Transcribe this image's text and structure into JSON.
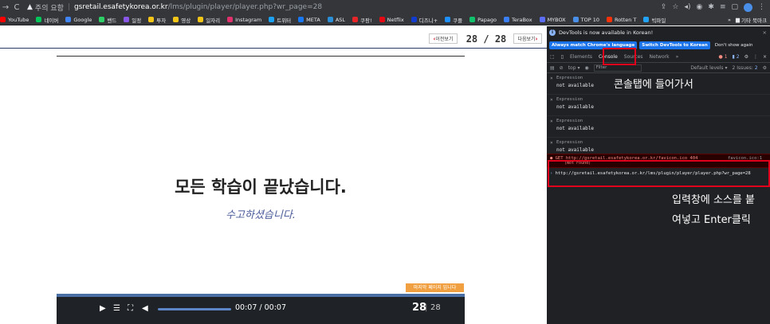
{
  "browser": {
    "warning": "주의 요함",
    "host": "gsretail.esafetykorea.or.kr",
    "path": "/lms/plugin/player/player.php?wr_page=28",
    "bookmarks": [
      {
        "label": "YouTube",
        "color": "#ff0000"
      },
      {
        "label": "네이버",
        "color": "#03c75a"
      },
      {
        "label": "Google",
        "color": "#4285f4"
      },
      {
        "label": "밴드",
        "color": "#2dcf66"
      },
      {
        "label": "일정",
        "color": "#8a56e8"
      },
      {
        "label": "투자",
        "color": "#f5c518"
      },
      {
        "label": "영상",
        "color": "#f5c518"
      },
      {
        "label": "일자리",
        "color": "#f5c518"
      },
      {
        "label": "Instagram",
        "color": "#e1306c"
      },
      {
        "label": "트위터",
        "color": "#1da1f2"
      },
      {
        "label": "META",
        "color": "#1877f2"
      },
      {
        "label": "ASL",
        "color": "#2a8fd6"
      },
      {
        "label": "쿠팡!",
        "color": "#e52528"
      },
      {
        "label": "Netflix",
        "color": "#e50914"
      },
      {
        "label": "디즈니+",
        "color": "#113ccf"
      },
      {
        "label": "쿠플",
        "color": "#1e90ff"
      },
      {
        "label": "Papago",
        "color": "#11c26d"
      },
      {
        "label": "TeraBox",
        "color": "#3b7ff6"
      },
      {
        "label": "MYBOX",
        "color": "#5b6ef5"
      },
      {
        "label": "TOP 10",
        "color": "#4a8fe7"
      },
      {
        "label": "Rotten T",
        "color": "#fa320a"
      },
      {
        "label": "빅파일",
        "color": "#22a3f5"
      }
    ],
    "bookmarks_other": "기타 북마크"
  },
  "page": {
    "prev_label": "이전보기",
    "next_label": "다음보기",
    "counter": "28 / 28",
    "title": "모든 학습이 끝났습니다.",
    "subtitle": "수고하셨습니다.",
    "last_page_badge": "마지막 페이지 입니다",
    "player": {
      "time": "00:07 / 00:07",
      "current_page": "28",
      "separator": "|",
      "total_pages": "28"
    }
  },
  "devtools": {
    "notice": "DevTools is now available in Korean!",
    "btn_match": "Always match Chrome's language",
    "btn_switch": "Switch DevTools to Korean",
    "btn_dont": "Don't show again",
    "tabs": [
      "Elements",
      "Console",
      "Sources",
      "Network"
    ],
    "error_count": "1",
    "info_count": "2",
    "context": "top",
    "filter_placeholder": "Filter",
    "levels": "Default levels",
    "issues": "2 Issues:",
    "issues_count": "2",
    "expressions": [
      {
        "label": "Expression",
        "value": "not available"
      },
      {
        "label": "Expression",
        "value": "not available"
      },
      {
        "label": "Expression",
        "value": "not available"
      },
      {
        "label": "Expression",
        "value": "not available"
      }
    ],
    "error": {
      "method": "GET",
      "url": "http://gsretail.esafetykorea.or.kr/favicon.ico",
      "status": "404",
      "status_text": "(Not Found)",
      "source": "favicon.ico:1"
    },
    "input_prompt": "›",
    "input_code": "http://gsretail.esafetykorea.or.kr/lms/plugin/player/player.php?wr_page=28"
  },
  "annotations": {
    "console_note": "콘솔탭에 들어가서",
    "input_note_1": "입력창에 소스를 붙",
    "input_note_2": "여넣고 Enter클릭"
  }
}
